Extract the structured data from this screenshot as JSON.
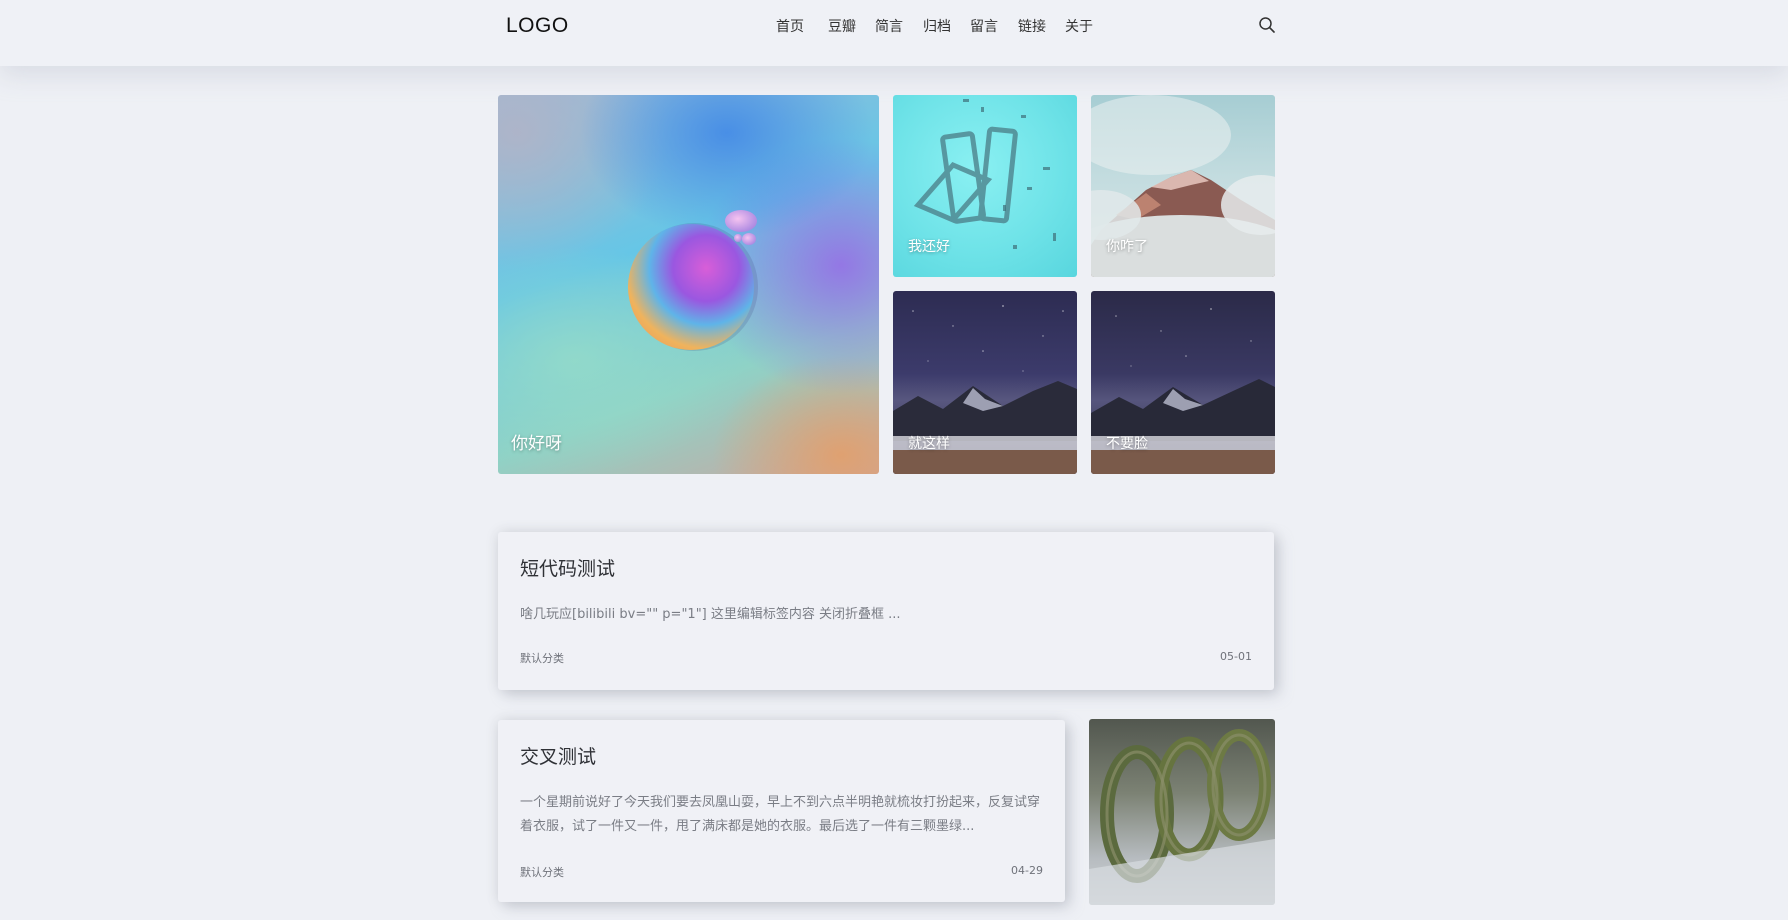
{
  "header": {
    "logo": "LOGO",
    "nav": [
      "首页",
      "豆瓣",
      "简言",
      "归档",
      "留言",
      "链接",
      "关于"
    ],
    "search_icon": "search-icon"
  },
  "featured": {
    "main_caption": "你好呀",
    "small_captions": [
      "我还好",
      "你咋了",
      "就这样",
      "不要脸"
    ]
  },
  "posts": [
    {
      "title": "短代码测试",
      "excerpt": "啥几玩应[bilibili bv=\"\" p=\"1\"] 这里编辑标签内容 关闭折叠框 ...",
      "category": "默认分类",
      "date": "05-01"
    },
    {
      "title": "交叉测试",
      "excerpt": "一个星期前说好了今天我们要去凤凰山耍，早上不到六点半明艳就梳妆打扮起来，反复试穿着衣服，试了一件又一件，甩了满床都是她的衣服。最后选了一件有三颗墨绿...",
      "category": "默认分类",
      "date": "04-29"
    }
  ],
  "colors": {
    "background": "#eef0f5",
    "header": "#eff1f6",
    "title_text": "#2f3136",
    "muted_text": "#7a7d85"
  }
}
